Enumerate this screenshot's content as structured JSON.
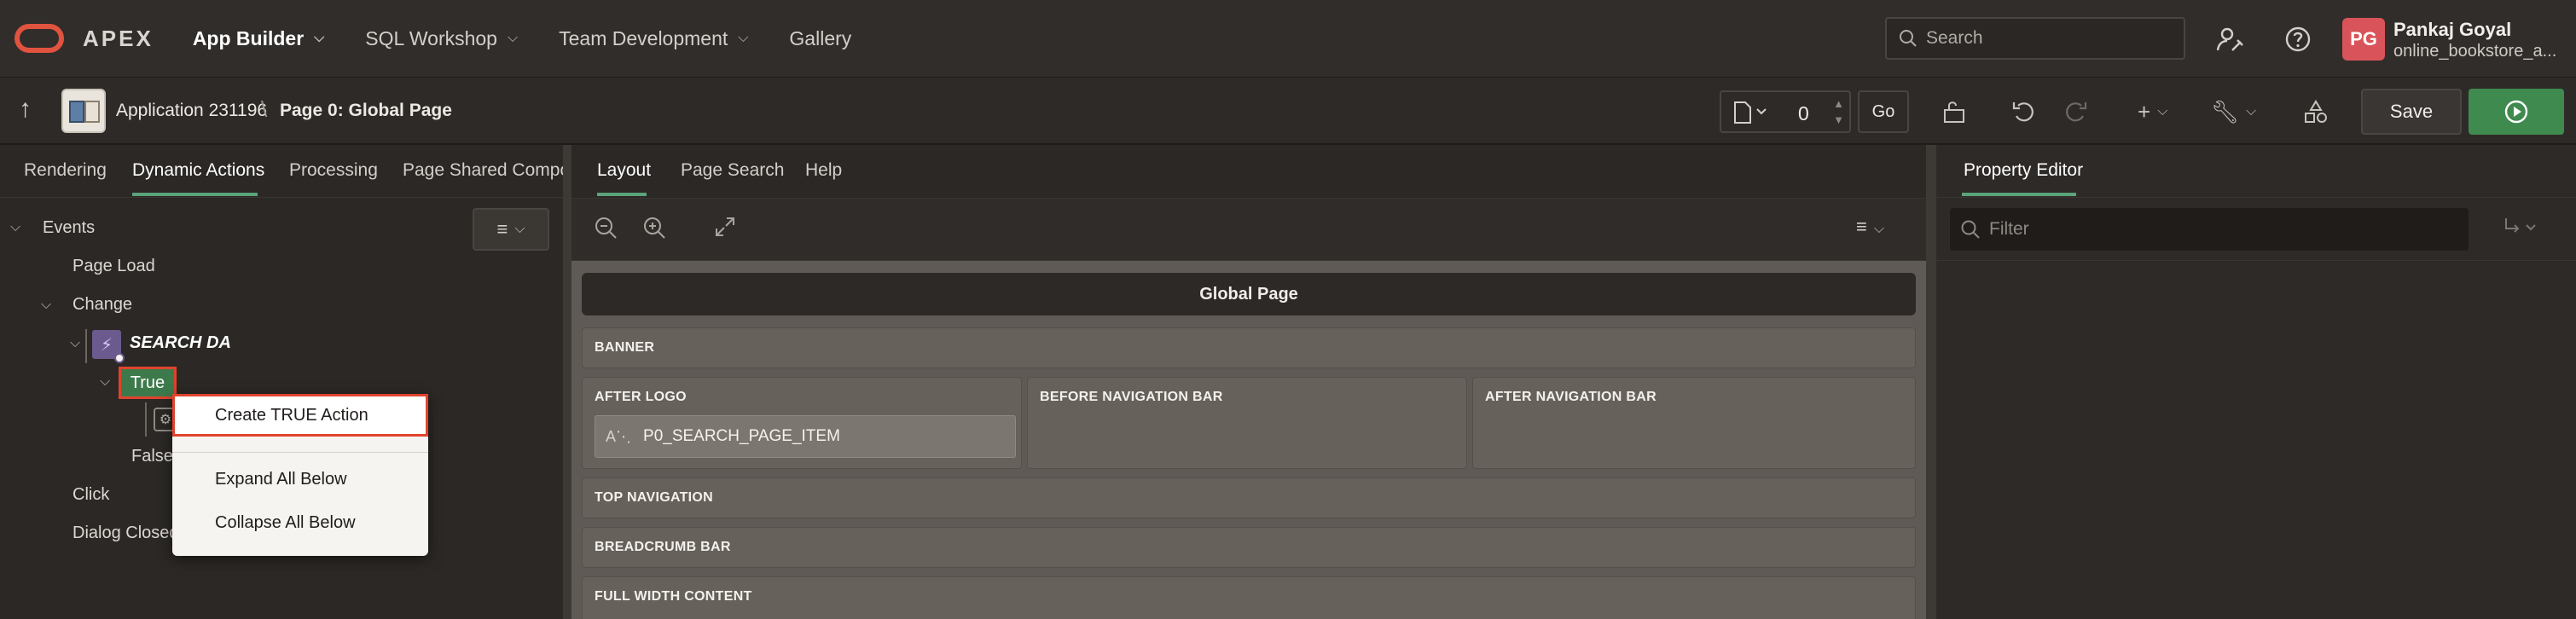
{
  "header": {
    "brand": "APEX",
    "nav": [
      {
        "label": "App Builder",
        "active": true,
        "has_menu": true
      },
      {
        "label": "SQL Workshop",
        "active": false,
        "has_menu": true
      },
      {
        "label": "Team Development",
        "active": false,
        "has_menu": true
      },
      {
        "label": "Gallery",
        "active": false,
        "has_menu": false
      }
    ],
    "search_placeholder": "Search",
    "user": {
      "initials": "PG",
      "name": "Pankaj Goyal",
      "workspace": "online_bookstore_a..."
    }
  },
  "toolbar": {
    "application": "Application 231196",
    "page": "Page 0: Global Page",
    "page_number": "0",
    "go_label": "Go",
    "save_label": "Save"
  },
  "left": {
    "tabs": [
      "Rendering",
      "Dynamic Actions",
      "Processing",
      "Page Shared Compor"
    ],
    "active_tab": "Dynamic Actions",
    "tree": {
      "events": "Events",
      "page_load": "Page Load",
      "change": "Change",
      "dynamic_action": "SEARCH DA",
      "true_node": "True",
      "false_node": "False",
      "click": "Click",
      "dialog_closed": "Dialog Closed"
    },
    "context_menu": [
      "Create TRUE Action",
      "Expand All Below",
      "Collapse All Below"
    ]
  },
  "center": {
    "tabs": [
      "Layout",
      "Page Search",
      "Help"
    ],
    "active_tab": "Layout",
    "page_title": "Global Page",
    "regions": {
      "banner": "BANNER",
      "after_logo": "AFTER LOGO",
      "before_nav": "BEFORE NAVIGATION BAR",
      "after_nav": "AFTER NAVIGATION BAR",
      "top_nav": "TOP NAVIGATION",
      "breadcrumb": "BREADCRUMB BAR",
      "full_width": "FULL WIDTH CONTENT"
    },
    "item": "P0_SEARCH_PAGE_ITEM"
  },
  "right": {
    "title": "Property Editor",
    "filter_placeholder": "Filter"
  },
  "colors": {
    "accent_green": "#5ba37a",
    "brand_red": "#e0533f",
    "highlight_red": "#e0432e",
    "run_green": "#3f8a4f"
  }
}
